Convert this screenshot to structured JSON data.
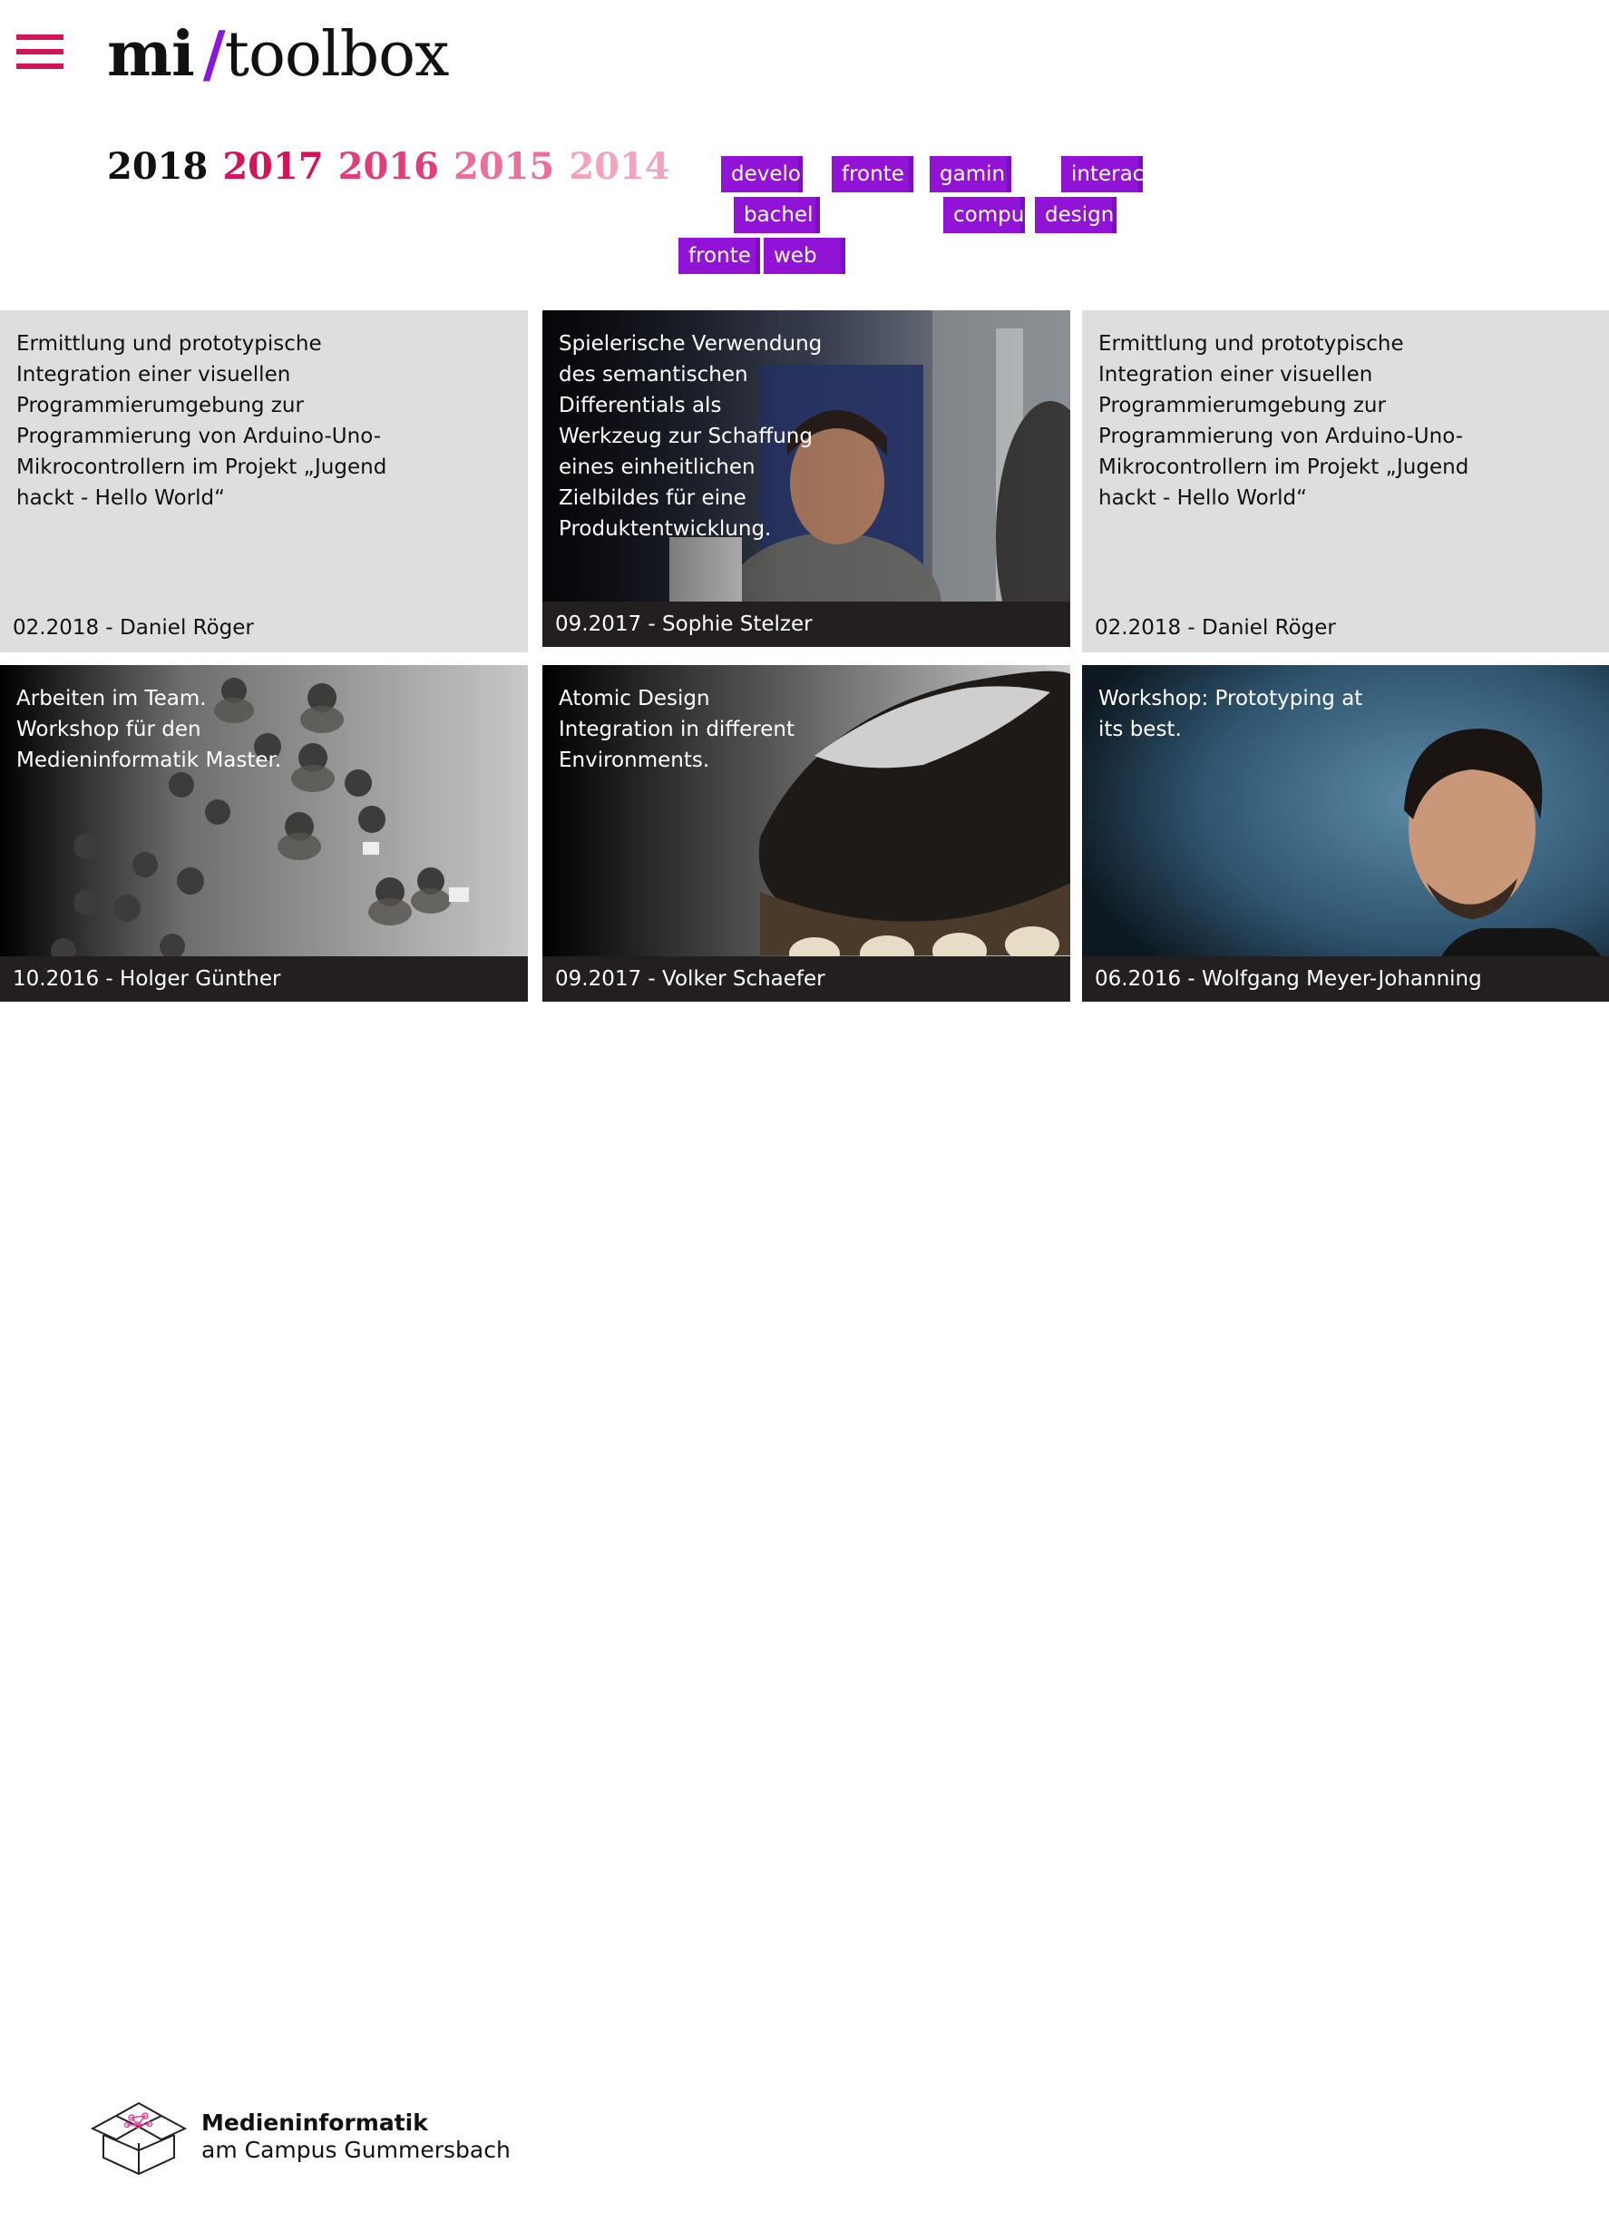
{
  "header": {
    "menu_icon": "hamburger-menu-icon",
    "logo": {
      "part1": "mi",
      "part2": "/",
      "part3": "toolbox"
    }
  },
  "colors": {
    "accent": "#d4145a",
    "tag": "#9013d6",
    "slash": "#8b17d8"
  },
  "years": [
    {
      "label": "2018",
      "color": "#111111"
    },
    {
      "label": "2017",
      "color": "#d4145a"
    },
    {
      "label": "2016",
      "color": "#e03d7a"
    },
    {
      "label": "2015",
      "color": "#ea6f9c"
    },
    {
      "label": "2014",
      "color": "#f2a3c0"
    }
  ],
  "tags": [
    "develo",
    "fronte",
    "gamin",
    "interac",
    "bachel",
    "compu",
    "design",
    "fronte",
    "web"
  ],
  "cards": [
    {
      "title": "Ermittlung und prototypische\nIntegration einer visuellen\nProgrammierumgebung zur\nProgrammierung von Arduino-Uno-\nMikrocontrollern im Projekt „Jugend\nhackt - Hello World“",
      "meta": "02.2018 - Daniel Röger",
      "image": "none"
    },
    {
      "title": "Spielerische Verwendung\ndes semantischen\nDifferentials als\nWerkzeug zur Schaffung\neines einheitlichen\nZielbildes für eine\nProduktentwicklung.",
      "meta": "09.2017 - Sophie Stelzer",
      "image": "portrait-man-in-office-photo"
    },
    {
      "title": "Ermittlung und prototypische\nIntegration einer visuellen\nProgrammierumgebung zur\nProgrammierung von Arduino-Uno-\nMikrocontrollern im Projekt „Jugend\nhackt - Hello World“",
      "meta": "02.2018 - Daniel Röger",
      "image": "none"
    },
    {
      "title": "Arbeiten im Team.\nWorkshop für den\nMedieninformatik Master.",
      "meta": "10.2016 - Holger Günther",
      "image": "people-from-above-photo"
    },
    {
      "title": "Atomic Design\nIntegration in different\nEnvironments.",
      "meta": "09.2017 - Volker Schaefer",
      "image": "football-boot-photo"
    },
    {
      "title": "Workshop: Prototyping at\nits best.",
      "meta": "06.2016 - Wolfgang Meyer-Johanning",
      "image": "portrait-young-man-photo"
    }
  ],
  "institution": {
    "logo_icon": "box-network-logo-icon",
    "name": "Medieninformatik",
    "subtitle": "am Campus Gummersbach"
  }
}
